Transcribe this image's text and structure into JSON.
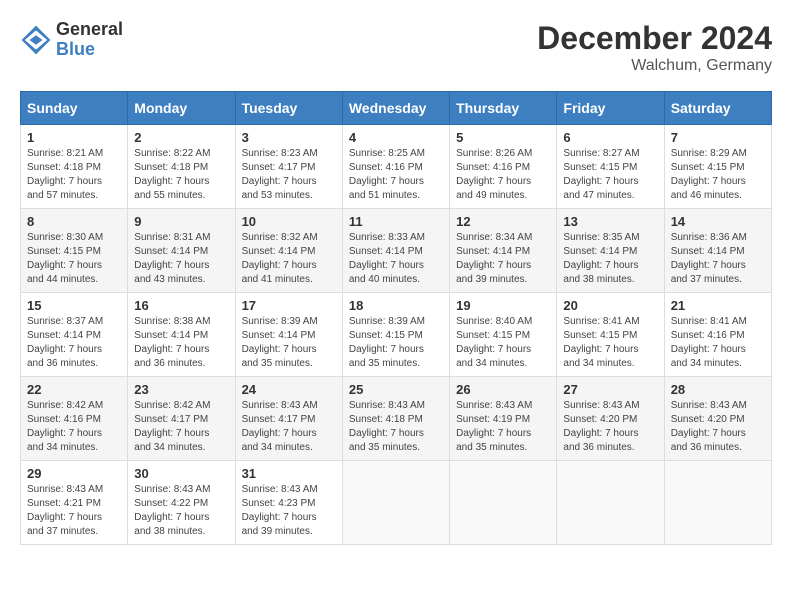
{
  "header": {
    "logo_general": "General",
    "logo_blue": "Blue",
    "title": "December 2024",
    "location": "Walchum, Germany"
  },
  "calendar": {
    "weekdays": [
      "Sunday",
      "Monday",
      "Tuesday",
      "Wednesday",
      "Thursday",
      "Friday",
      "Saturday"
    ],
    "weeks": [
      [
        {
          "day": "1",
          "sunrise": "8:21 AM",
          "sunset": "4:18 PM",
          "daylight": "7 hours and 57 minutes."
        },
        {
          "day": "2",
          "sunrise": "8:22 AM",
          "sunset": "4:18 PM",
          "daylight": "7 hours and 55 minutes."
        },
        {
          "day": "3",
          "sunrise": "8:23 AM",
          "sunset": "4:17 PM",
          "daylight": "7 hours and 53 minutes."
        },
        {
          "day": "4",
          "sunrise": "8:25 AM",
          "sunset": "4:16 PM",
          "daylight": "7 hours and 51 minutes."
        },
        {
          "day": "5",
          "sunrise": "8:26 AM",
          "sunset": "4:16 PM",
          "daylight": "7 hours and 49 minutes."
        },
        {
          "day": "6",
          "sunrise": "8:27 AM",
          "sunset": "4:15 PM",
          "daylight": "7 hours and 47 minutes."
        },
        {
          "day": "7",
          "sunrise": "8:29 AM",
          "sunset": "4:15 PM",
          "daylight": "7 hours and 46 minutes."
        }
      ],
      [
        {
          "day": "8",
          "sunrise": "8:30 AM",
          "sunset": "4:15 PM",
          "daylight": "7 hours and 44 minutes."
        },
        {
          "day": "9",
          "sunrise": "8:31 AM",
          "sunset": "4:14 PM",
          "daylight": "7 hours and 43 minutes."
        },
        {
          "day": "10",
          "sunrise": "8:32 AM",
          "sunset": "4:14 PM",
          "daylight": "7 hours and 41 minutes."
        },
        {
          "day": "11",
          "sunrise": "8:33 AM",
          "sunset": "4:14 PM",
          "daylight": "7 hours and 40 minutes."
        },
        {
          "day": "12",
          "sunrise": "8:34 AM",
          "sunset": "4:14 PM",
          "daylight": "7 hours and 39 minutes."
        },
        {
          "day": "13",
          "sunrise": "8:35 AM",
          "sunset": "4:14 PM",
          "daylight": "7 hours and 38 minutes."
        },
        {
          "day": "14",
          "sunrise": "8:36 AM",
          "sunset": "4:14 PM",
          "daylight": "7 hours and 37 minutes."
        }
      ],
      [
        {
          "day": "15",
          "sunrise": "8:37 AM",
          "sunset": "4:14 PM",
          "daylight": "7 hours and 36 minutes."
        },
        {
          "day": "16",
          "sunrise": "8:38 AM",
          "sunset": "4:14 PM",
          "daylight": "7 hours and 36 minutes."
        },
        {
          "day": "17",
          "sunrise": "8:39 AM",
          "sunset": "4:14 PM",
          "daylight": "7 hours and 35 minutes."
        },
        {
          "day": "18",
          "sunrise": "8:39 AM",
          "sunset": "4:15 PM",
          "daylight": "7 hours and 35 minutes."
        },
        {
          "day": "19",
          "sunrise": "8:40 AM",
          "sunset": "4:15 PM",
          "daylight": "7 hours and 34 minutes."
        },
        {
          "day": "20",
          "sunrise": "8:41 AM",
          "sunset": "4:15 PM",
          "daylight": "7 hours and 34 minutes."
        },
        {
          "day": "21",
          "sunrise": "8:41 AM",
          "sunset": "4:16 PM",
          "daylight": "7 hours and 34 minutes."
        }
      ],
      [
        {
          "day": "22",
          "sunrise": "8:42 AM",
          "sunset": "4:16 PM",
          "daylight": "7 hours and 34 minutes."
        },
        {
          "day": "23",
          "sunrise": "8:42 AM",
          "sunset": "4:17 PM",
          "daylight": "7 hours and 34 minutes."
        },
        {
          "day": "24",
          "sunrise": "8:43 AM",
          "sunset": "4:17 PM",
          "daylight": "7 hours and 34 minutes."
        },
        {
          "day": "25",
          "sunrise": "8:43 AM",
          "sunset": "4:18 PM",
          "daylight": "7 hours and 35 minutes."
        },
        {
          "day": "26",
          "sunrise": "8:43 AM",
          "sunset": "4:19 PM",
          "daylight": "7 hours and 35 minutes."
        },
        {
          "day": "27",
          "sunrise": "8:43 AM",
          "sunset": "4:20 PM",
          "daylight": "7 hours and 36 minutes."
        },
        {
          "day": "28",
          "sunrise": "8:43 AM",
          "sunset": "4:20 PM",
          "daylight": "7 hours and 36 minutes."
        }
      ],
      [
        {
          "day": "29",
          "sunrise": "8:43 AM",
          "sunset": "4:21 PM",
          "daylight": "7 hours and 37 minutes."
        },
        {
          "day": "30",
          "sunrise": "8:43 AM",
          "sunset": "4:22 PM",
          "daylight": "7 hours and 38 minutes."
        },
        {
          "day": "31",
          "sunrise": "8:43 AM",
          "sunset": "4:23 PM",
          "daylight": "7 hours and 39 minutes."
        },
        null,
        null,
        null,
        null
      ]
    ]
  }
}
